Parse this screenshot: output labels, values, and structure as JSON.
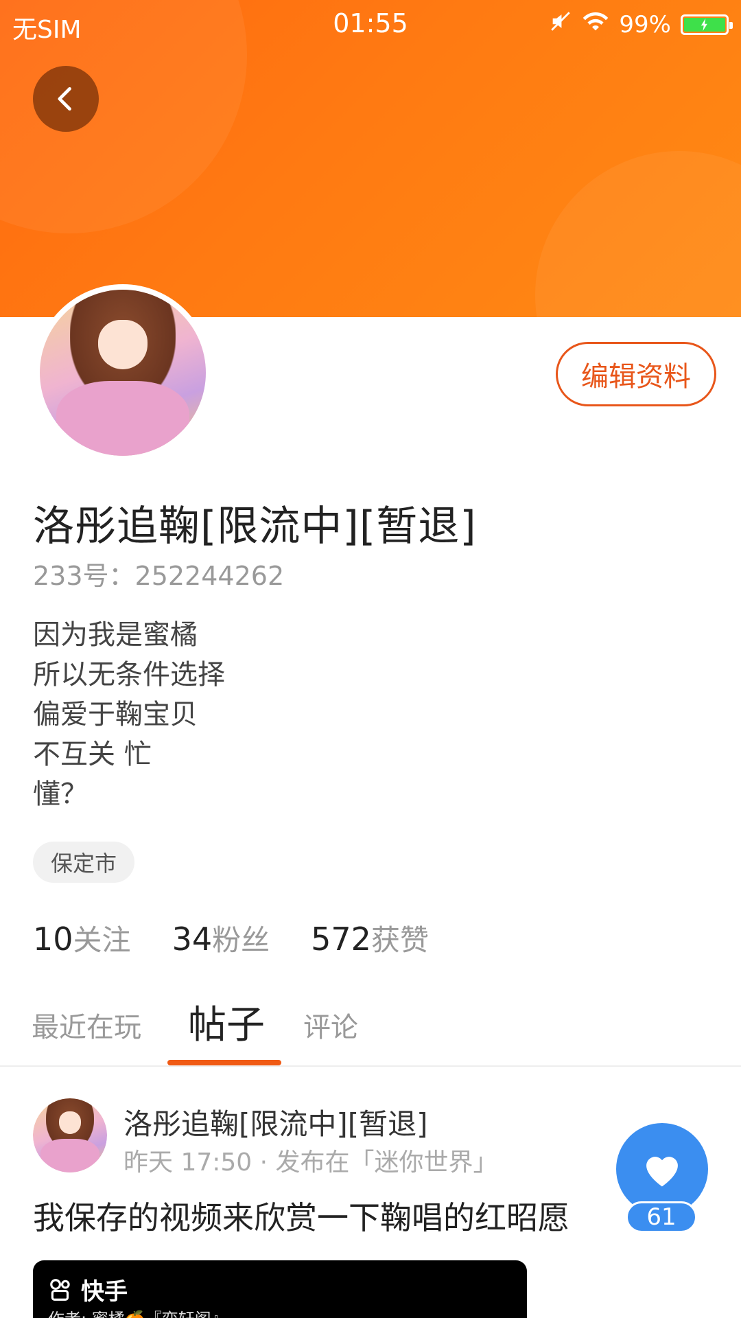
{
  "status_bar": {
    "carrier": "无SIM",
    "time": "01:55",
    "battery": "99%"
  },
  "profile": {
    "edit_label": "编辑资料",
    "username": "洛彤追鞠[限流中][暂退]",
    "uid": "233号：252244262",
    "bio": [
      "因为我是蜜橘",
      "所以无条件选择",
      "偏爱于鞠宝贝",
      "不互关 忙",
      "懂？"
    ],
    "location": "保定市",
    "stats": [
      {
        "num": "10",
        "label": "关注"
      },
      {
        "num": "34",
        "label": "粉丝"
      },
      {
        "num": "572",
        "label": "获赞"
      }
    ]
  },
  "tabs": [
    {
      "label": "最近在玩"
    },
    {
      "label": "帖子"
    },
    {
      "label": "评论"
    }
  ],
  "post": {
    "author": "洛彤追鞠[限流中][暂退]",
    "meta": "昨天 17:50 · 发布在「迷你世界」",
    "text": "我保存的视频来欣赏一下鞠唱的红昭愿",
    "like_count": "61",
    "video_brand": "快手",
    "video_byline": "作者: 蜜橘🍊『弈轩阁』"
  },
  "colors": {
    "accent": "#f05a14",
    "banner": "#ff7a12",
    "like": "#3b8ef0"
  }
}
